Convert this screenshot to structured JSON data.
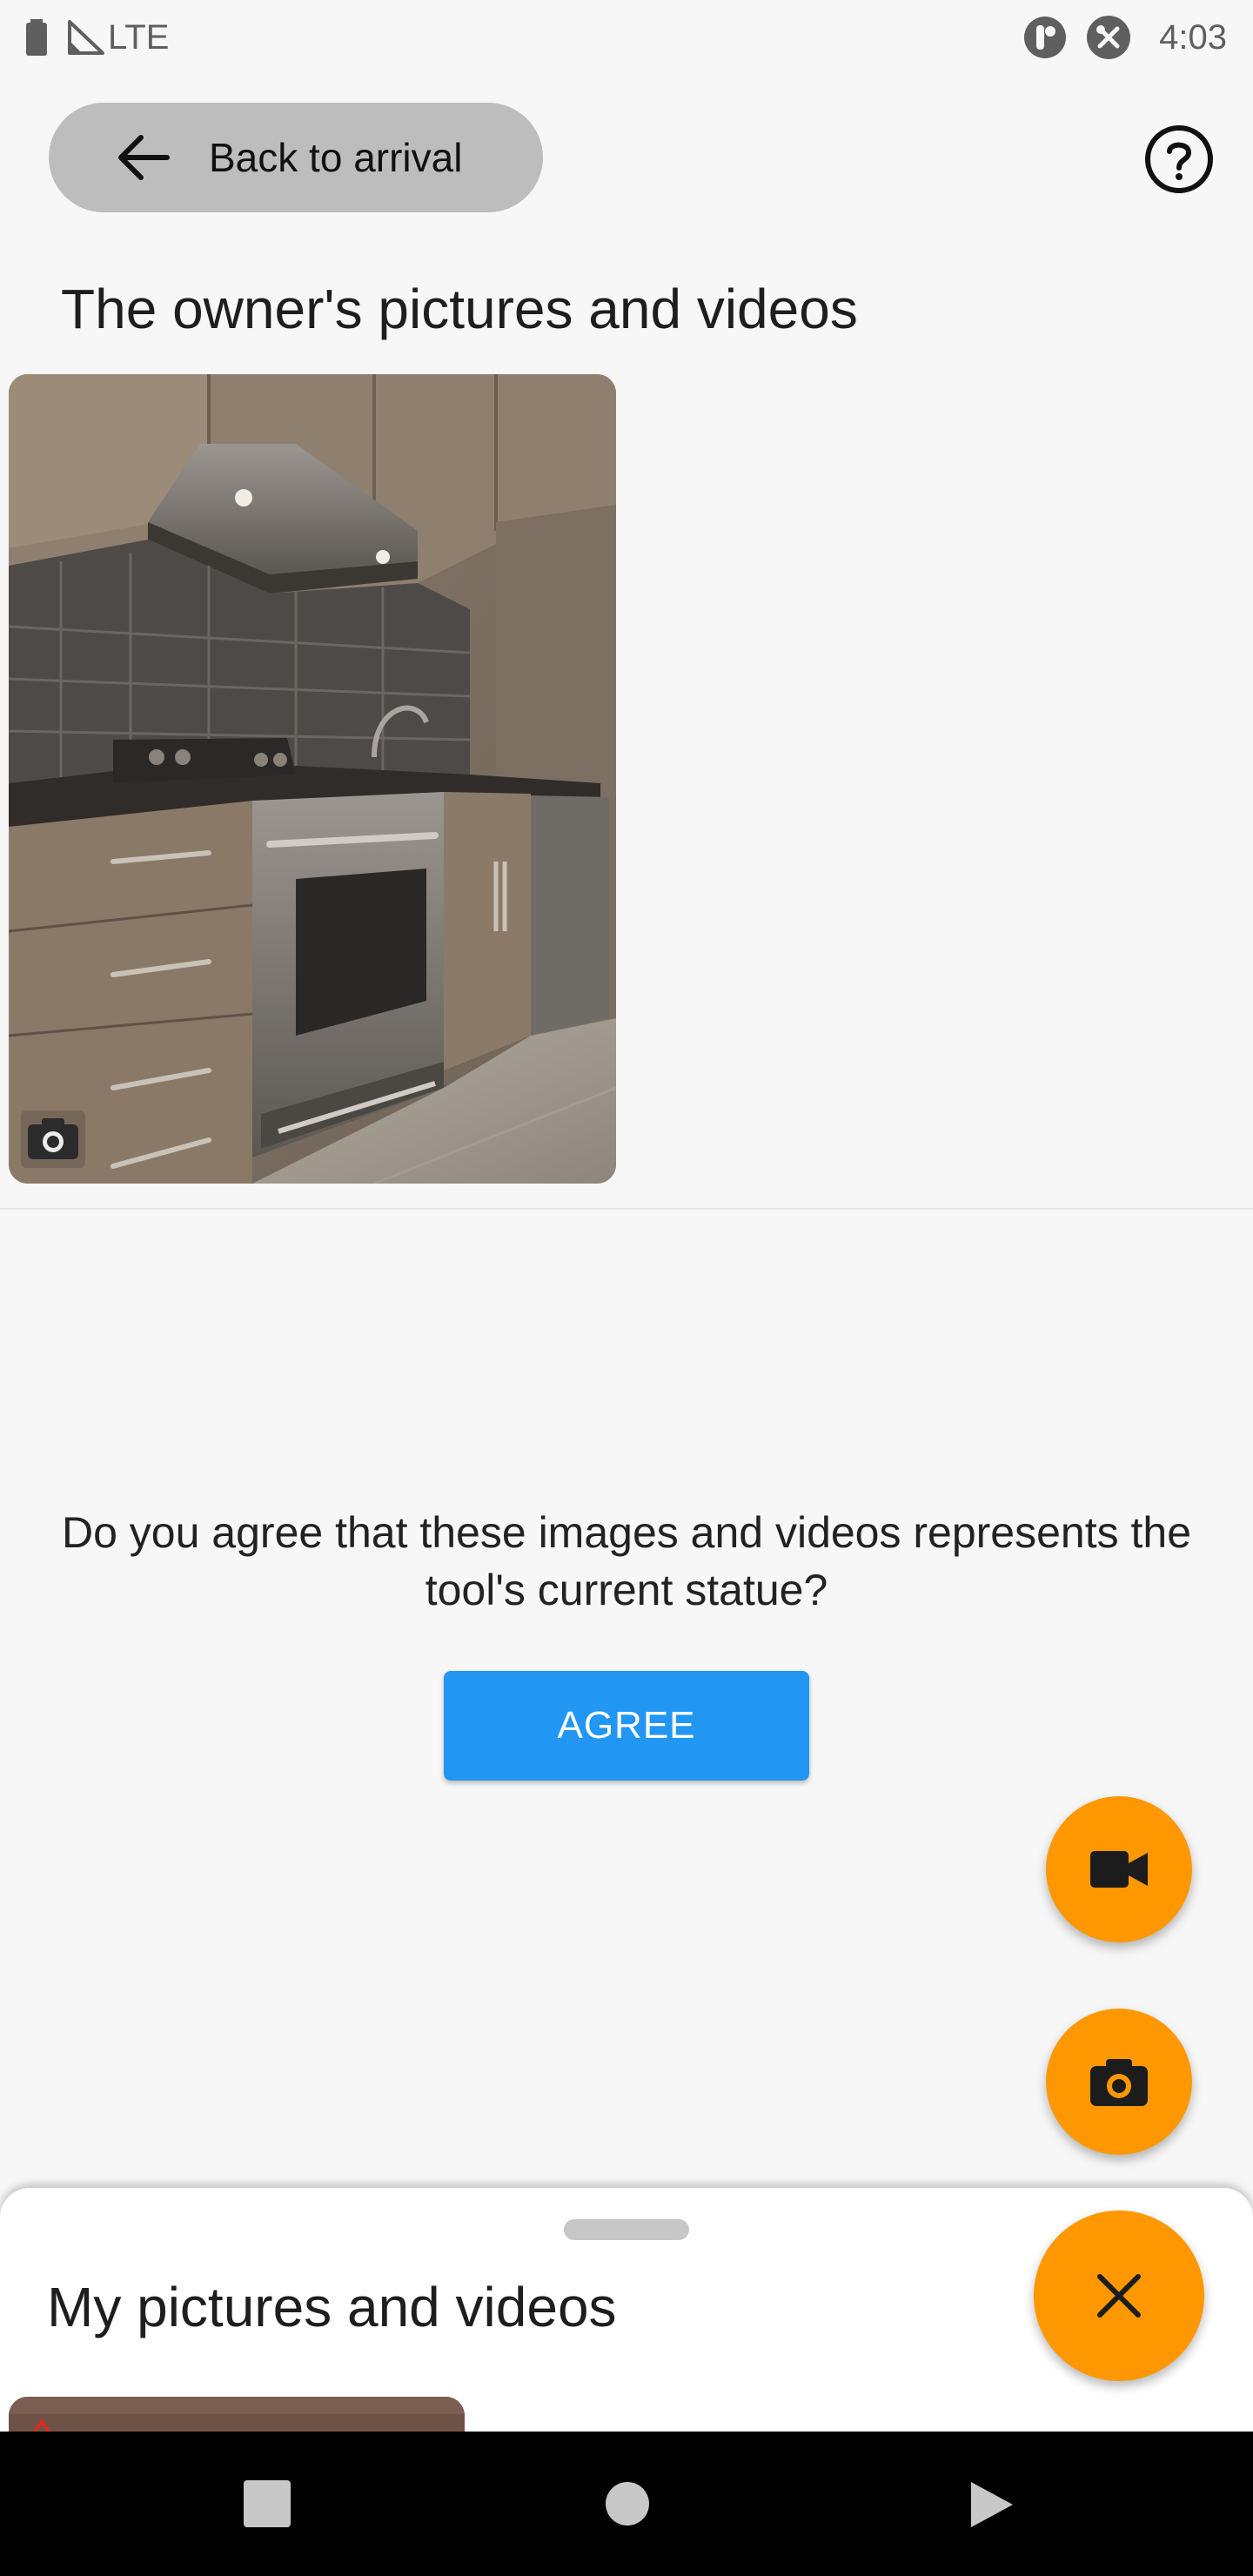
{
  "status_bar": {
    "network": "LTE",
    "time": "4:03",
    "icons": [
      "battery-icon",
      "signal-icon",
      "app-notification-icon",
      "tools-notification-icon"
    ]
  },
  "app_bar": {
    "back_label": "Back to arrival",
    "back_icon": "arrow-left-icon",
    "help_icon": "help-circle-icon"
  },
  "owner_section": {
    "title": "The owner's pictures and videos",
    "media": [
      {
        "type": "photo",
        "subject": "kitchen",
        "badge_icon": "camera-icon"
      }
    ]
  },
  "confirmation": {
    "question": "Do you agree that these images and videos represents the tool's current statue?",
    "agree_label": "AGREE"
  },
  "fabs": {
    "video_icon": "videocam-icon",
    "photo_icon": "camera-icon",
    "close_icon": "close-icon"
  },
  "bottom_sheet": {
    "title": "My pictures and videos"
  },
  "colors": {
    "accent_orange": "#ff9800",
    "primary_blue": "#2196f3",
    "back_pill": "#bdbdbd",
    "background": "#f7f7f7"
  }
}
